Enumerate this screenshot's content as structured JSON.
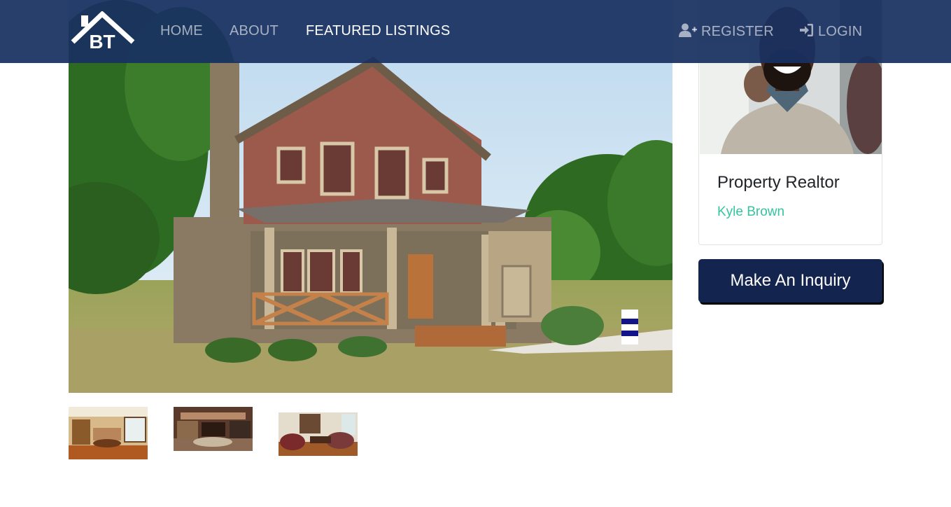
{
  "navbar": {
    "logo_text": "BT",
    "links": [
      {
        "label": "HOME",
        "active": false
      },
      {
        "label": "ABOUT",
        "active": false
      },
      {
        "label": "FEATURED LISTINGS",
        "active": true
      }
    ],
    "register": {
      "label": "REGISTER",
      "icon": "user-plus-icon"
    },
    "login": {
      "label": "LOGIN",
      "icon": "sign-in-icon"
    }
  },
  "listing": {
    "main_image": "craftsman-house-photo",
    "thumbnails": [
      "kitchen-dining-photo",
      "living-room-photo",
      "family-room-photo"
    ]
  },
  "realtor": {
    "title": "Property Realtor",
    "name": "Kyle Brown"
  },
  "inquiry_button": {
    "label": "Make An Inquiry"
  },
  "colors": {
    "navbar": "#193060",
    "accent": "#36c4a0",
    "button": "#13244f"
  }
}
